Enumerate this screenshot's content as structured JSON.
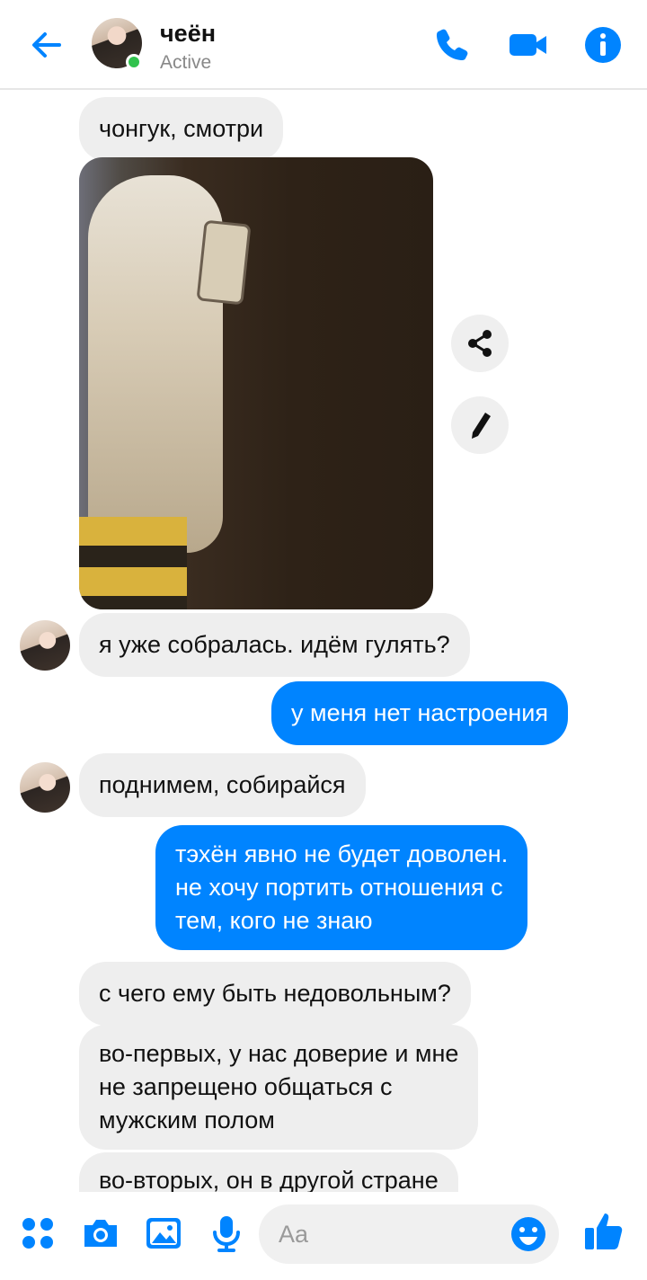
{
  "header": {
    "name": "чеён",
    "status": "Active",
    "icons": [
      "back-arrow-icon",
      "phone-icon",
      "video-camera-icon",
      "info-icon"
    ]
  },
  "messages": [
    {
      "id": 0,
      "side": "in",
      "text": "чонгук, смотри"
    },
    {
      "id": 1,
      "side": "in",
      "type": "image",
      "image_desc": "mirror selfie photo"
    },
    {
      "id": 2,
      "side": "in",
      "text": "я уже собралась. идём гулять?"
    },
    {
      "id": 3,
      "side": "out",
      "text": "у меня нет настроения"
    },
    {
      "id": 4,
      "side": "in",
      "text": "поднимем, собирайся"
    },
    {
      "id": 5,
      "side": "out",
      "lines": [
        "тэхён явно не будет доволен.",
        "не хочу портить отношения с",
        "тем, кого не знаю"
      ]
    },
    {
      "id": 6,
      "side": "in",
      "text": "с чего ему быть недовольным?"
    },
    {
      "id": 7,
      "side": "in",
      "lines": [
        "во-первых, у нас доверие и мне",
        "не запрещено общаться с",
        "мужским полом"
      ]
    },
    {
      "id": 8,
      "side": "in",
      "text": "во-вторых, он в другой стране"
    }
  ],
  "composer": {
    "placeholder": "Aa",
    "icons": [
      "menu-dots-icon",
      "camera-icon",
      "gallery-icon",
      "microphone-icon",
      "emoji-icon",
      "thumbs-up-icon"
    ]
  },
  "colors": {
    "accent": "#0084ff",
    "incoming_bubble": "#eeeeee",
    "active": "#31c24d"
  }
}
